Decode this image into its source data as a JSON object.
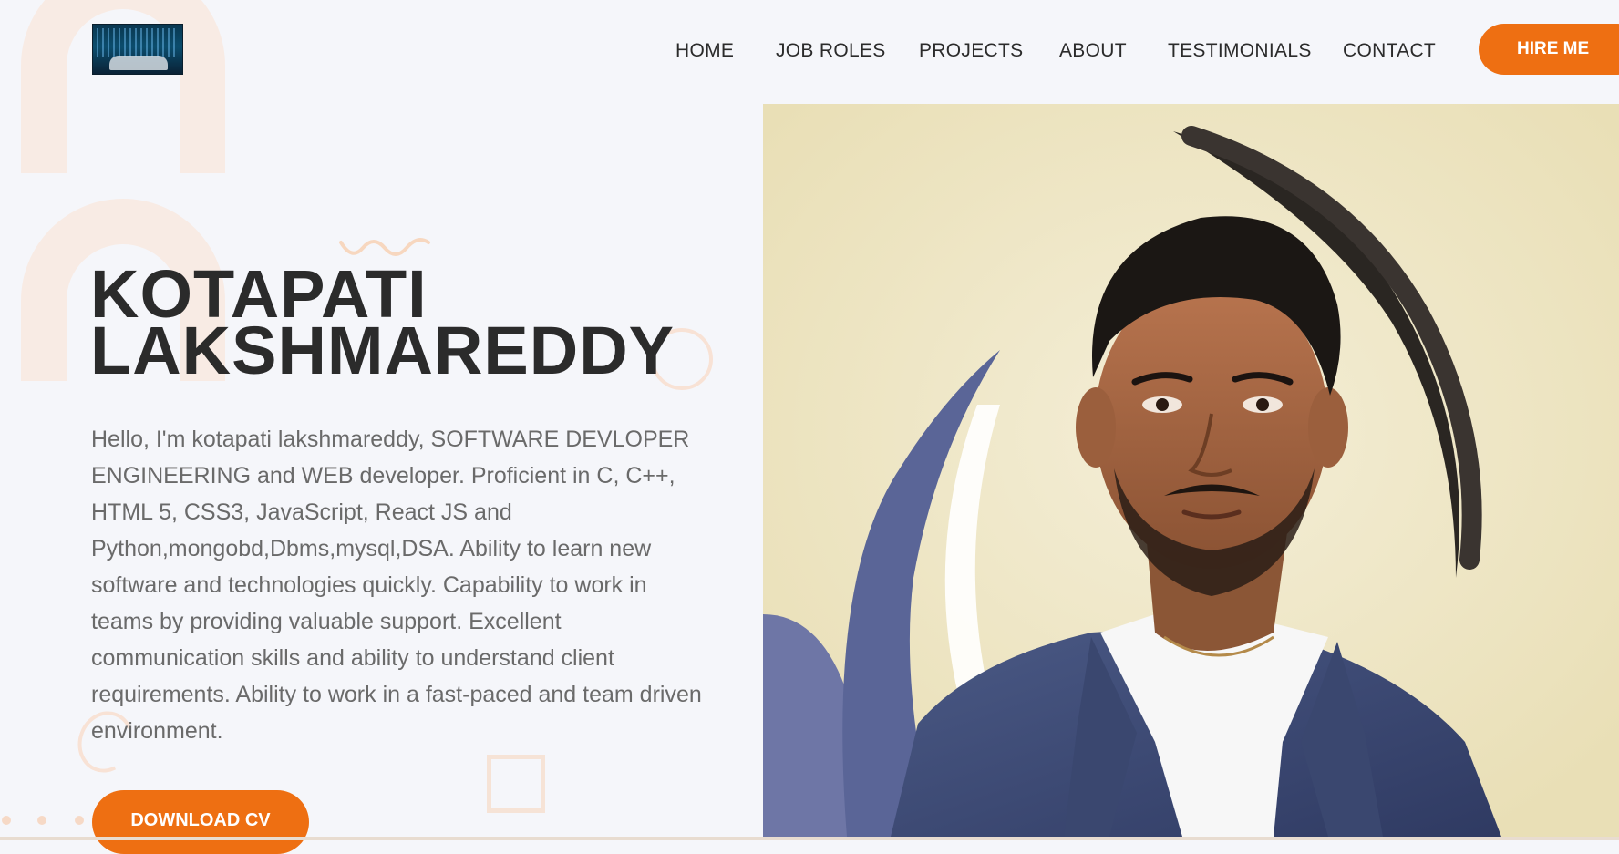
{
  "brand": {
    "logo_icon": "keyboard-hands-logo"
  },
  "nav": {
    "items": [
      "HOME",
      "JOB ROLES",
      "PROJECTS",
      "ABOUT",
      "TESTIMONIALS",
      "CONTACT"
    ],
    "cta_label": "HIRE ME"
  },
  "hero": {
    "name_line1": "KOTAPATI",
    "name_line2": "LAKSHMAREDDY",
    "bio": "Hello, I'm kotapati lakshmareddy, SOFTWARE DEVLOPER ENGINEERING and WEB developer. Proficient in C, C++, HTML 5, CSS3, JavaScript, React JS and Python,mongobd,Dbms,mysql,DSA. Ability to learn new software and technologies quickly. Capability to work in teams by providing valuable support. Excellent communication skills and ability to understand client requirements. Ability to work in a fast-paced and team driven environment.",
    "cta_label": "DOWNLOAD CV",
    "portrait_icon": "profile-portrait"
  },
  "colors": {
    "accent": "#ee6f12",
    "background": "#f5f6fa",
    "heading": "#2b2b2b",
    "body_text": "#6a6a6a",
    "deco_peach": "#f8ebe4"
  }
}
